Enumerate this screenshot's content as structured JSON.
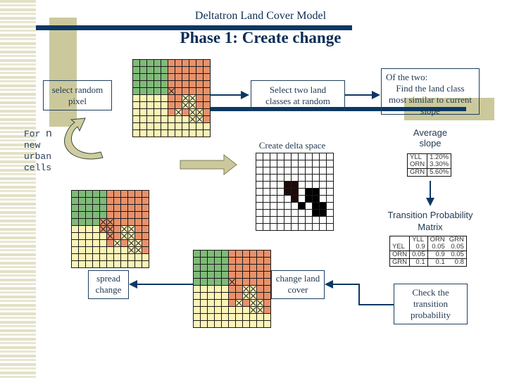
{
  "header": {
    "subtitle": "Deltatron Land Cover Model",
    "title": "Phase 1: Create change"
  },
  "colors": {
    "navy": "#0b3864",
    "olive": "#cbc99c",
    "green": "#7fbb78",
    "orange": "#e8916a",
    "yellow": "#fcf3b6"
  },
  "steps": {
    "select_pixel": "select random pixel",
    "select_classes": "Select two land classes at random",
    "find_class_line1": "Of the two:",
    "find_class_line2": "Find the land class most similar to current slope",
    "delta_space": "Create delta space",
    "average_slope": "Average slope",
    "transition_matrix": "Transition Probability Matrix",
    "check_transition": "Check the transition probability",
    "change_land_cover": "change land cover",
    "spread_change": "spread change"
  },
  "loop_label": {
    "for": "For",
    "n": "n",
    "rest": [
      "new",
      "urban",
      "cells"
    ]
  },
  "average_slope_table": [
    {
      "class": "YLL",
      "value": "1.20%"
    },
    {
      "class": "ORN",
      "value": "3.30%"
    },
    {
      "class": "GRN",
      "value": "5.60%"
    }
  ],
  "transition_matrix": {
    "columns": [
      "YLL",
      "ORN",
      "GRN"
    ],
    "rows": [
      {
        "label": "YEL",
        "values": [
          "0.9",
          "0.05",
          "0.05"
        ]
      },
      {
        "label": "ORN",
        "values": [
          "0.05",
          "0.9",
          "0.05"
        ]
      },
      {
        "label": "GRN",
        "values": [
          "0.1",
          "0.1",
          "0.8"
        ]
      }
    ]
  },
  "grids": {
    "land_cover": [
      "gggggoooooo",
      "gggggoooooo",
      "gggggoooooo",
      "gggggoooooo",
      "gggggXooooo",
      "yyyyyooZZoo",
      "yyyyyooZZoo",
      "yyyyyoZoZZo",
      "yyyyyyyyZZo",
      "yyyyyyyyyyy",
      "yyyyyyyyyyy"
    ],
    "spread": [
      "gggggoooooo",
      "gggggoooooo",
      "gggggoooooo",
      "gggggoooooo",
      "ggggXXooooo",
      "yyyyXXoZZoo",
      "yyyyyXoZZoo",
      "yyyyyoZoZZo",
      "yyyyyyyyZZo",
      "yyyyyyyyyyy",
      "yyyyyyyyyyy"
    ],
    "delta": [
      "wwwwwwwwwww",
      "wwwwwwwwwww",
      "wwwwwwwwwww",
      "wwwwwwwwwww",
      "wwwwddwwwww",
      "wwwwddwbbww",
      "wwwwwdwbbww",
      "wwwwwwbwbbw",
      "wwwwwwwwbbw",
      "wwwwwwwwwww",
      "wwwwwwwwwww"
    ]
  }
}
